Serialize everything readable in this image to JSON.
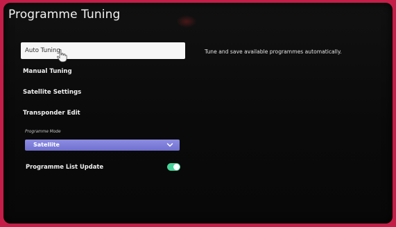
{
  "page": {
    "title": "Programme Tuning"
  },
  "menu": {
    "items": [
      {
        "label": "Auto Tuning",
        "selected": true
      },
      {
        "label": "Manual Tuning",
        "selected": false
      },
      {
        "label": "Satellite Settings",
        "selected": false
      },
      {
        "label": "Transponder Edit",
        "selected": false
      }
    ]
  },
  "description": "Tune and save available programmes automatically.",
  "programme_mode": {
    "label": "Programme Mode",
    "value": "Satellite",
    "icon": "chevron-down-icon"
  },
  "programme_list_update": {
    "label": "Programme List Update",
    "enabled": true
  },
  "colors": {
    "frame_border": "#c41e48",
    "select_fill": "#7f7fda",
    "toggle_on": "#46d39a"
  }
}
